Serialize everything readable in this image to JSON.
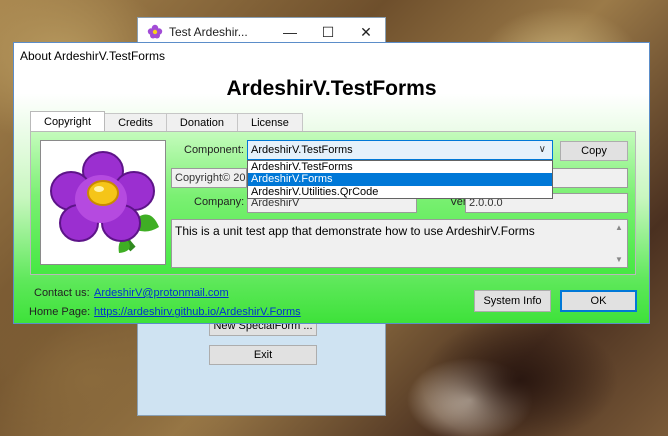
{
  "background_window": {
    "title": "Test Ardeshir...",
    "minimize_glyph": "—",
    "maximize_glyph": "☐",
    "close_glyph": "✕",
    "buttons": [
      "New SpecialForm ...",
      "Exit"
    ]
  },
  "dialog": {
    "title": "About ArdeshirV.TestForms",
    "heading": "ArdeshirV.TestForms",
    "tabs": [
      {
        "label": "Copyright",
        "active": true
      },
      {
        "label": "Credits",
        "active": false
      },
      {
        "label": "Donation",
        "active": false
      },
      {
        "label": "License",
        "active": false
      }
    ],
    "component_label": "Component:",
    "component_value": "ArdeshirV.TestForms",
    "dropdown_options": [
      {
        "label": "ArdeshirV.TestForms",
        "selected": false
      },
      {
        "label": "ArdeshirV.Forms",
        "selected": true
      },
      {
        "label": "ArdeshirV.Utilities.QrCode",
        "selected": false
      }
    ],
    "copy_button": "Copy",
    "copyright_value": "Copyright© 200",
    "company_label": "Company:",
    "company_value": "ArdeshirV",
    "version_label": "Version:",
    "version_value": "2.0.0.0",
    "description": "This is a unit test app that demonstrate how to use ArdeshirV.Forms",
    "contact_label": "Contact us:",
    "contact_value": "ArdeshirV@protonmail.com",
    "homepage_label": "Home Page:",
    "homepage_value": "https://ardeshirv.github.io/ArdeshirV.Forms",
    "system_info_button": "System Info",
    "ok_button": "OK"
  },
  "colors": {
    "dialog_gradient_bottom": "#3ee23a",
    "selection": "#0078d7",
    "link": "#0033cc"
  },
  "icons": {
    "app": "flower-icon",
    "logo": "flower-logo"
  }
}
